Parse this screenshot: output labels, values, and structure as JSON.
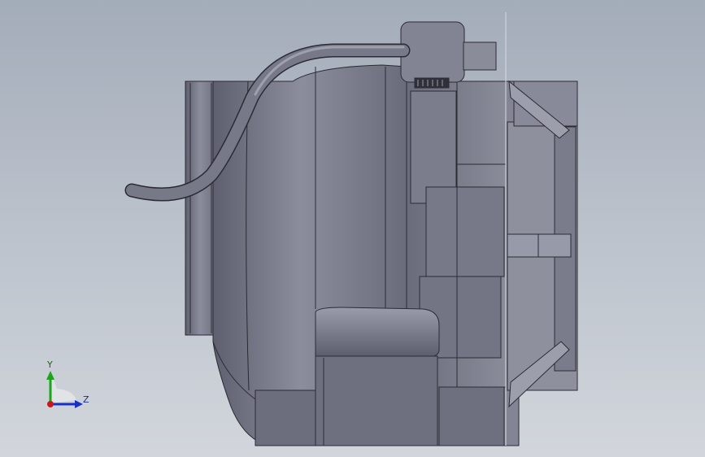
{
  "viewport": {
    "background_top": "#a3acb9",
    "background_bottom": "#d2d6dc"
  },
  "model": {
    "icon": "blower-motor-assembly",
    "body_color": "#7c7e8f",
    "shadow_color": "#4f5160",
    "highlight_color": "#a7a9b8",
    "edge_color": "#2a2b33"
  },
  "triad": {
    "y_label": "Y",
    "z_label": "Z",
    "y_color": "#1aa51a",
    "z_color": "#1730c8",
    "x_color": "#c81919"
  }
}
